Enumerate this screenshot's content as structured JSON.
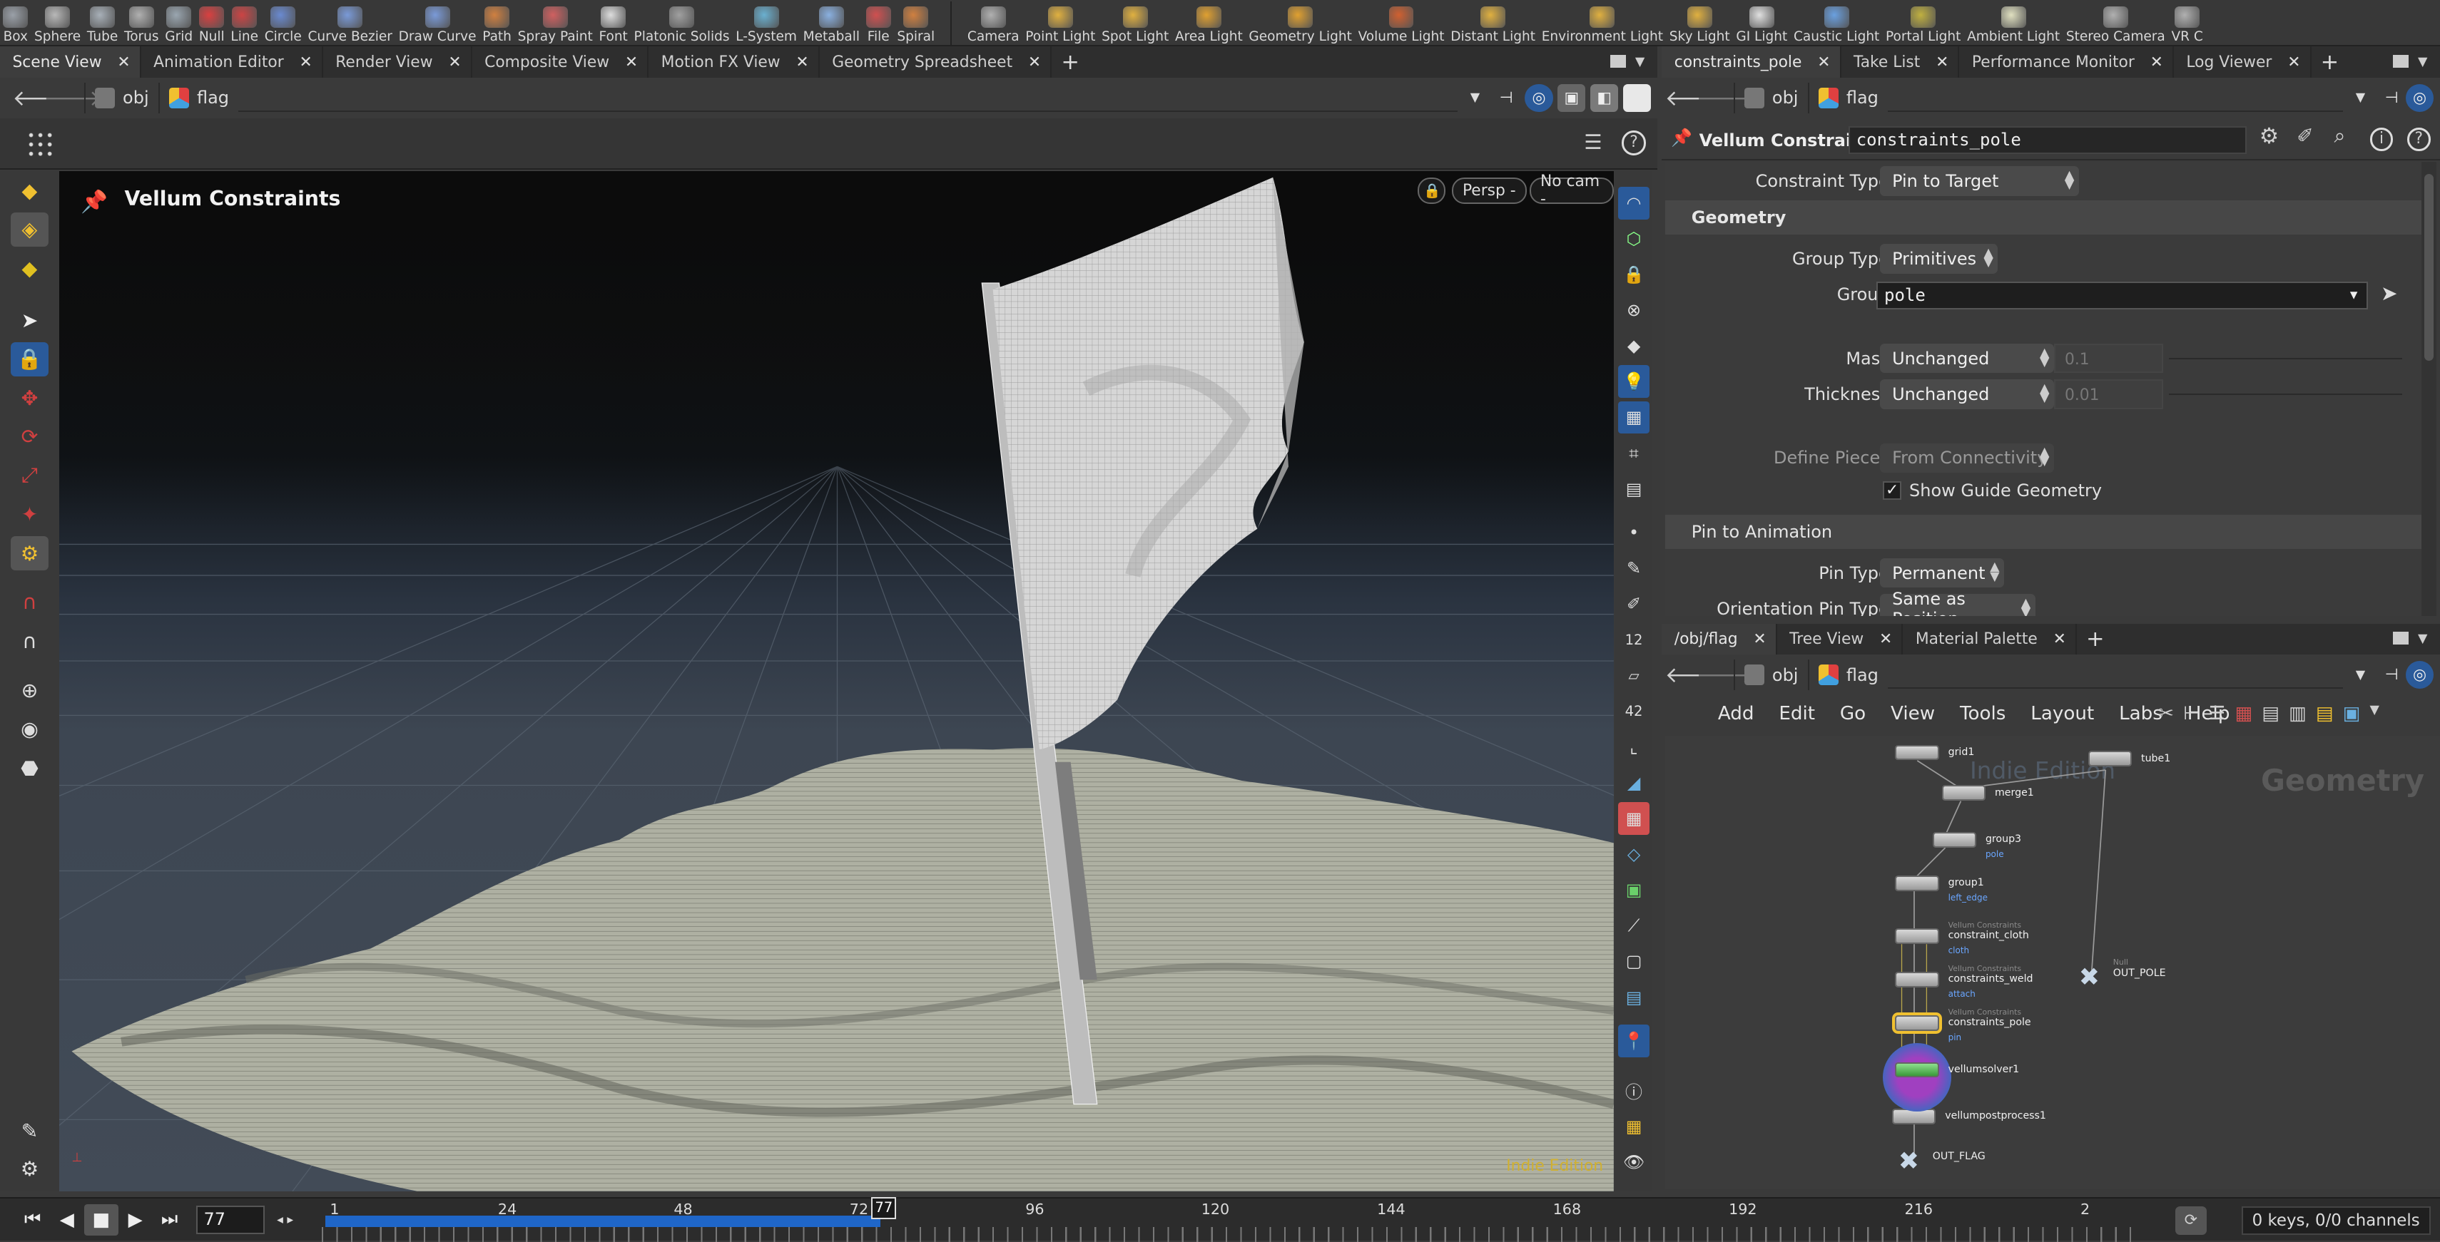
{
  "shelf": {
    "left_tools": [
      {
        "label": "Box",
        "icon": "box-icon",
        "color": "#9aa0a8"
      },
      {
        "label": "Sphere",
        "icon": "sphere-icon",
        "color": "#b8b8b8"
      },
      {
        "label": "Tube",
        "icon": "tube-icon",
        "color": "#a8b0b8"
      },
      {
        "label": "Torus",
        "icon": "torus-icon",
        "color": "#b0b0b0"
      },
      {
        "label": "Grid",
        "icon": "grid-icon",
        "color": "#9aa6b0"
      },
      {
        "label": "Null",
        "icon": "null-icon",
        "color": "#d94040"
      },
      {
        "label": "Line",
        "icon": "line-icon",
        "color": "#cc4444"
      },
      {
        "label": "Circle",
        "icon": "circle-icon",
        "color": "#6a8ad0"
      },
      {
        "label": "Curve Bezier",
        "icon": "curve-bezier-icon",
        "color": "#7a9ad8"
      },
      {
        "label": "Draw Curve",
        "icon": "draw-curve-icon",
        "color": "#7a9ad8"
      },
      {
        "label": "Path",
        "icon": "path-icon",
        "color": "#d08040"
      },
      {
        "label": "Spray Paint",
        "icon": "spray-paint-icon",
        "color": "#d06060"
      },
      {
        "label": "Font",
        "icon": "font-icon",
        "color": "#dddddd"
      },
      {
        "label": "Platonic Solids",
        "icon": "platonic-solids-icon",
        "color": "#a0a0a0"
      },
      {
        "label": "L-System",
        "icon": "l-system-icon",
        "color": "#6ab0d0"
      },
      {
        "label": "Metaball",
        "icon": "metaball-icon",
        "color": "#8ab0e0"
      },
      {
        "label": "File",
        "icon": "file-icon",
        "color": "#d05050"
      },
      {
        "label": "Spiral",
        "icon": "spiral-icon",
        "color": "#d08040"
      }
    ],
    "right_tools": [
      {
        "label": "Camera",
        "icon": "camera-icon",
        "color": "#b0b0b0"
      },
      {
        "label": "Point Light",
        "icon": "point-light-icon",
        "color": "#e0b040"
      },
      {
        "label": "Spot Light",
        "icon": "spot-light-icon",
        "color": "#e0b040"
      },
      {
        "label": "Area Light",
        "icon": "area-light-icon",
        "color": "#e0a030"
      },
      {
        "label": "Geometry Light",
        "icon": "geometry-light-icon",
        "color": "#e0a030"
      },
      {
        "label": "Volume Light",
        "icon": "volume-light-icon",
        "color": "#d06030"
      },
      {
        "label": "Distant Light",
        "icon": "distant-light-icon",
        "color": "#e0b040"
      },
      {
        "label": "Environment Light",
        "icon": "environment-light-icon",
        "color": "#e0b040"
      },
      {
        "label": "Sky Light",
        "icon": "sky-light-icon",
        "color": "#e0b040"
      },
      {
        "label": "GI Light",
        "icon": "gi-light-icon",
        "color": "#e0e0e0"
      },
      {
        "label": "Caustic Light",
        "icon": "caustic-light-icon",
        "color": "#6aa0e0"
      },
      {
        "label": "Portal Light",
        "icon": "portal-light-icon",
        "color": "#c0b040"
      },
      {
        "label": "Ambient Light",
        "icon": "ambient-light-icon",
        "color": "#e0e0c0"
      },
      {
        "label": "Stereo Camera",
        "icon": "stereo-camera-icon",
        "color": "#b0b0b0"
      },
      {
        "label": "VR C",
        "icon": "vr-camera-icon",
        "color": "#b0b0b0"
      }
    ]
  },
  "left_tabs": [
    {
      "label": "Scene View",
      "active": true
    },
    {
      "label": "Animation Editor"
    },
    {
      "label": "Render View"
    },
    {
      "label": "Composite View"
    },
    {
      "label": "Motion FX View"
    },
    {
      "label": "Geometry Spreadsheet"
    }
  ],
  "right_top_tabs": [
    {
      "label": "constraints_pole",
      "active": true
    },
    {
      "label": "Take List"
    },
    {
      "label": "Performance Monitor"
    },
    {
      "label": "Log Viewer"
    }
  ],
  "right_bottom_tabs": [
    {
      "label": "/obj/flag",
      "active": true
    },
    {
      "label": "Tree View"
    },
    {
      "label": "Material Palette"
    }
  ],
  "path": {
    "root": "obj",
    "node": "flag"
  },
  "viewport": {
    "title": "Vellum Constraints",
    "persp": "Persp -",
    "cam": "No cam -",
    "watermark": "Indie Edition"
  },
  "params": {
    "node_type": "Vellum Constraints",
    "node_name": "constraints_pole",
    "constraint_type_label": "Constraint Type",
    "constraint_type": "Pin to Target",
    "geometry_section": "Geometry",
    "group_type_label": "Group Type",
    "group_type": "Primitives",
    "group_label": "Group",
    "group_value": "pole",
    "mass_label": "Mass",
    "mass_mode": "Unchanged",
    "mass_value": "0.1",
    "thickness_label": "Thickness",
    "thickness_mode": "Unchanged",
    "thickness_value": "0.01",
    "define_pieces_label": "Define Pieces",
    "define_pieces": "From Connectivity",
    "show_guide_label": "Show Guide Geometry",
    "pin_section": "Pin to Animation",
    "pin_type_label": "Pin Type",
    "pin_type": "Permanent",
    "orient_pin_label": "Orientation Pin Type",
    "orient_pin": "Same as Position"
  },
  "network": {
    "menu": [
      "Add",
      "Edit",
      "Go",
      "View",
      "Tools",
      "Layout",
      "Labs",
      "Help"
    ],
    "context_label": "Geometry",
    "watermark": "Indie Edition",
    "nodes": [
      {
        "name": "grid1",
        "sub": "",
        "top": ""
      },
      {
        "name": "merge1",
        "sub": "",
        "top": ""
      },
      {
        "name": "group3",
        "sub": "pole",
        "top": ""
      },
      {
        "name": "group1",
        "sub": "left_edge",
        "top": ""
      },
      {
        "name": "constraint_cloth",
        "sub": "cloth",
        "top": "Vellum Constraints"
      },
      {
        "name": "constraints_weld",
        "sub": "attach",
        "top": "Vellum Constraints"
      },
      {
        "name": "constraints_pole",
        "sub": "pin",
        "top": "Vellum Constraints"
      },
      {
        "name": "vellumsolver1",
        "sub": "",
        "top": ""
      },
      {
        "name": "vellumpostprocess1",
        "sub": "",
        "top": ""
      },
      {
        "name": "OUT_FLAG",
        "sub": "",
        "top": ""
      },
      {
        "name": "tube1",
        "sub": "",
        "top": ""
      },
      {
        "name": "OUT_POLE",
        "sub": "",
        "top": "Null"
      }
    ]
  },
  "timeline": {
    "frame": "77",
    "ticks": [
      "1",
      "24",
      "48",
      "72",
      "96",
      "120",
      "144",
      "168",
      "192",
      "216",
      "2"
    ],
    "current": "77",
    "keys_info": "0 keys, 0/0 channels"
  },
  "colors": {
    "accent": "#f0c030",
    "selection": "#1f66c8",
    "bg": "#3a3a3a"
  }
}
